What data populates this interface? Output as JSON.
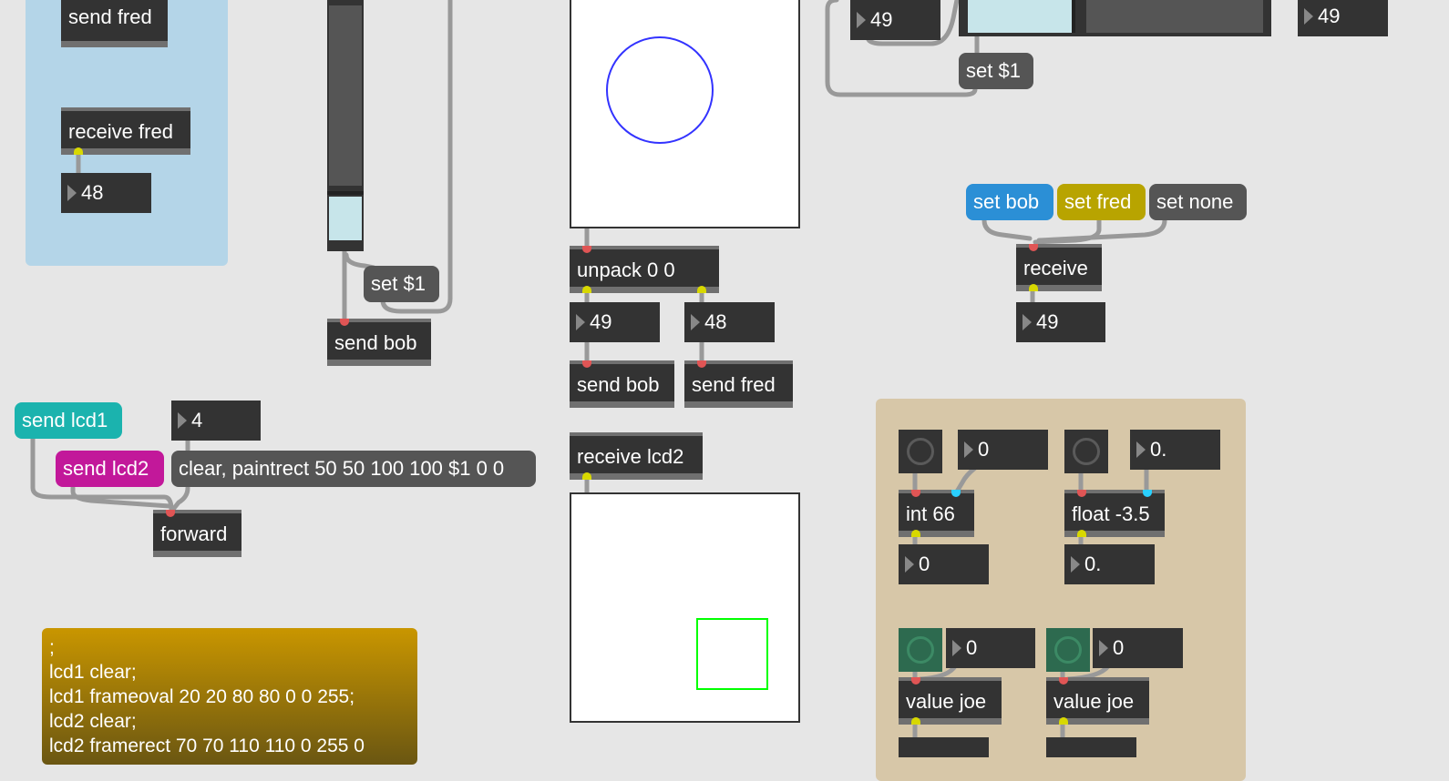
{
  "patch": {
    "blue_panel": {
      "send": "send fred",
      "receive": "receive fred",
      "number": "48"
    },
    "slider_section": {
      "set_msg": "set $1",
      "send": "send bob"
    },
    "lcd1_section": {
      "unpack": "unpack 0 0",
      "num_left": "49",
      "num_right": "48",
      "send_left": "send bob",
      "send_right": "send fred"
    },
    "top_right": {
      "num_left": "49",
      "num_right": "49",
      "set_msg": "set $1"
    },
    "receive_section": {
      "set_bob": "set bob",
      "set_fred": "set fred",
      "set_none": "set none",
      "receive": "receive",
      "number": "49"
    },
    "forward_section": {
      "send_lcd1": "send lcd1",
      "send_lcd2": "send lcd2",
      "number": "4",
      "clear_msg": "clear, paintrect 50 50 100 100 $1 0 0",
      "forward": "forward"
    },
    "lcd2_section": {
      "receive": "receive lcd2"
    },
    "comment_lines": [
      ";",
      "lcd1 clear;",
      "lcd1 frameoval 20 20 80 80 0 0 255;",
      "lcd2 clear;",
      "lcd2 framerect 70 70 110 110 0 255 0"
    ],
    "tan_panel": {
      "num_a": "0",
      "num_b": "0.",
      "int_obj": "int 66",
      "float_obj": "float -3.5",
      "num_c": "0",
      "num_d": "0.",
      "num_e": "0",
      "num_f": "0",
      "value_a": "value joe",
      "value_b": "value joe"
    }
  },
  "colors": {
    "canvas": "#e6e6e6",
    "blue_panel": "#b4d5e8",
    "tan_panel": "#d7c7a8",
    "teal_msg": "#1bb3ae",
    "magenta_msg": "#c2189a",
    "blue_msg": "#2b8fd6",
    "olive_msg": "#b8a400",
    "slider_fill": "#c7e5ea",
    "oval_stroke": "#3333ff",
    "rect_stroke": "#00ff00"
  },
  "icons": [
    "bang-icon",
    "number-arrow-icon"
  ]
}
